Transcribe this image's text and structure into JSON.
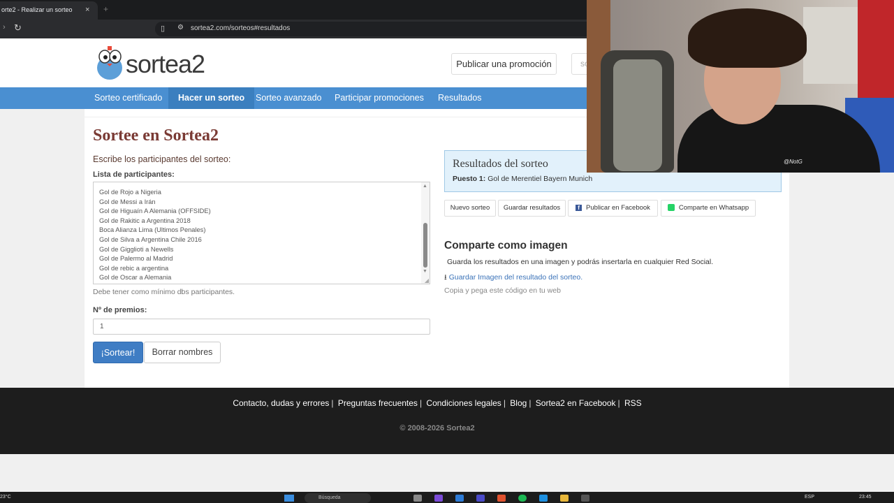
{
  "browser": {
    "tab_title": "orte2 - Realizar un sorteo",
    "tab_close": "×",
    "new_tab": "+",
    "url": "sortea2.com/sorteos#resultados"
  },
  "header": {
    "logo_text": "sortea2",
    "publish_label": "Publicar una promoción",
    "search_placeholder": "so"
  },
  "nav": {
    "items": [
      "Sorteo certificado",
      "Hacer un sorteo",
      "Sorteo avanzado",
      "Participar promociones",
      "Resultados"
    ],
    "active": "Hacer un sorteo"
  },
  "form": {
    "title": "Sortee en Sortea2",
    "subtitle": "Escribe los participantes del sorteo:",
    "list_label": "Lista de participantes:",
    "participants": [
      "Gol de Rojo a Nigeria",
      "Gol de Messi a Irán",
      "Gol de Higuaín A Alemania (OFFSIDE)",
      "Gol de Rakitic a Argentina 2018",
      "Boca Alianza Lima (Ultimos Penales)",
      "Gol de Silva a Argentina Chile 2016",
      "Gol de Gigglioti a Newells",
      "Gol de Palermo al Madrid",
      "Gol de rebic a argentina",
      "Gol de Oscar a Alemania"
    ],
    "min_note": "Debe tener como mínimo dos participantes.",
    "prizes_label": "Nº de premios:",
    "prizes_value": "1",
    "draw_label": "¡Sortear!",
    "clear_label": "Borrar nombres"
  },
  "results": {
    "title": "Resultados del sorteo",
    "place_label": "Puesto 1:",
    "place_value": "Gol de Merentiel Bayern Munich",
    "buttons": {
      "new": "Nuevo sorteo",
      "save": "Guardar resultados",
      "facebook": "Publicar en Facebook",
      "whatsapp": "Comparte en Whatsapp"
    }
  },
  "share": {
    "title": "Comparte como imagen",
    "desc": "Guarda los resultados en una imagen y podrás insertarla en cualquier Red Social.",
    "save_image": "Guardar Imagen del resultado del sorteo.",
    "embed_note": "Copia y pega este código en tu web"
  },
  "footer": {
    "links": [
      "Contacto, dudas y errores",
      "Preguntas frecuentes",
      "Condiciones legales",
      "Blog",
      "Sortea2 en Facebook",
      "RSS"
    ],
    "copyright": "© 2008-2026 Sortea2"
  },
  "taskbar": {
    "weather": "23°C",
    "search_label": "Búsqueda",
    "lang": "ESP",
    "time": "23:45"
  },
  "webcam": {
    "watermark": "@NotG"
  },
  "colors": {
    "nav_blue": "#4a8fd1",
    "title_brown": "#7a3a34",
    "primary_button": "#3f7dc4",
    "results_bg": "#e2f1fb"
  }
}
